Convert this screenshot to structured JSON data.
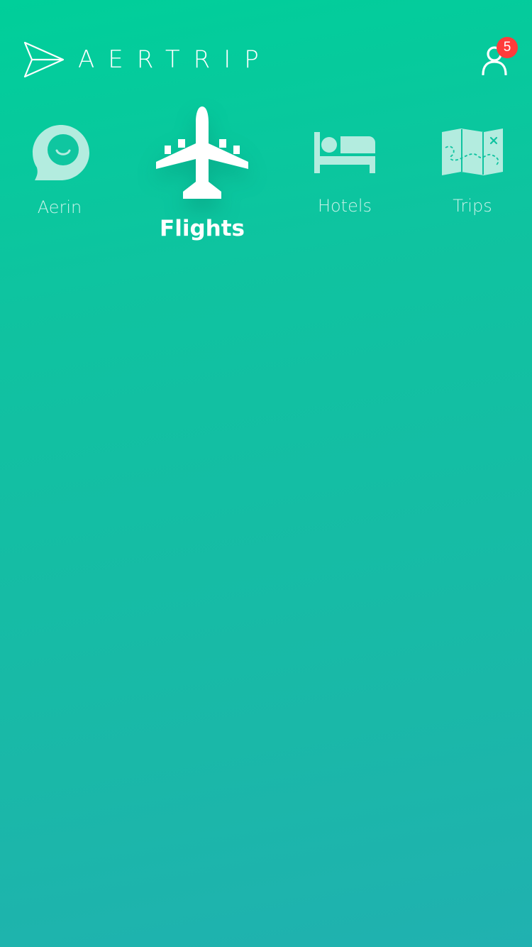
{
  "app": {
    "brand_name": "AERTRIP",
    "logo_icon": "paper-plane-icon"
  },
  "header": {
    "profile_icon": "user-icon",
    "notification_count": "5"
  },
  "nav": {
    "items": [
      {
        "label": "Aerin",
        "icon": "chat-bubble-smile-icon",
        "active": false
      },
      {
        "label": "Flights",
        "icon": "airplane-icon",
        "active": true
      },
      {
        "label": "Hotels",
        "icon": "bed-icon",
        "active": false
      },
      {
        "label": "Trips",
        "icon": "map-icon",
        "active": false
      }
    ]
  },
  "colors": {
    "gradient_top": "#00cf9a",
    "gradient_bottom": "#20b1b0",
    "badge": "#ff3b3b",
    "text": "#ffffff"
  }
}
